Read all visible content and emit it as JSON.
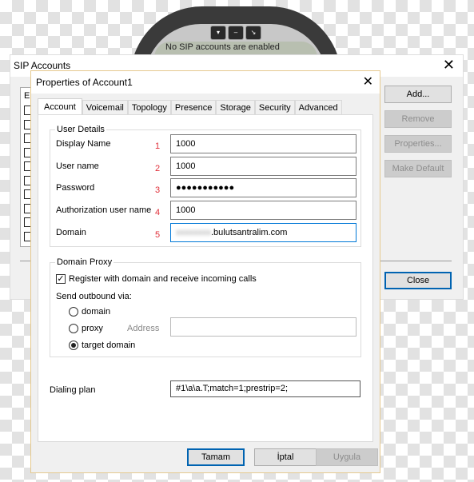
{
  "phone": {
    "status": "No SIP accounts are enabled",
    "buttons": [
      "▾",
      "–",
      "↘"
    ]
  },
  "sip_accounts": {
    "title": "SIP Accounts",
    "column_header": "En",
    "row_count": 10,
    "buttons": {
      "add": "Add...",
      "remove": "Remove",
      "properties": "Properties...",
      "make_default": "Make Default",
      "close": "Close"
    }
  },
  "dialog": {
    "title": "Properties of Account1",
    "tabs": [
      {
        "label": "Account",
        "active": true
      },
      {
        "label": "Voicemail"
      },
      {
        "label": "Topology"
      },
      {
        "label": "Presence"
      },
      {
        "label": "Storage"
      },
      {
        "label": "Security"
      },
      {
        "label": "Advanced"
      }
    ],
    "user_details": {
      "legend": "User Details",
      "fields": [
        {
          "label": "Display Name",
          "num": "1",
          "value": "1000"
        },
        {
          "label": "User name",
          "num": "2",
          "value": "1000"
        },
        {
          "label": "Password",
          "num": "3",
          "value": "●●●●●●●●●●●"
        },
        {
          "label": "Authorization user name",
          "num": "4",
          "value": "1000"
        },
        {
          "label": "Domain",
          "num": "5",
          "value": ".bulutsantralim.com"
        }
      ]
    },
    "domain_proxy": {
      "legend": "Domain Proxy",
      "register_label": "Register with domain and receive incoming calls",
      "register_checked": true,
      "send_outbound_label": "Send outbound via:",
      "options": [
        "domain",
        "proxy",
        "target domain"
      ],
      "selected": "target domain",
      "address_label": "Address",
      "address_value": ""
    },
    "dialing_plan": {
      "label": "Dialing plan",
      "value": "#1\\a\\a.T;match=1;prestrip=2;"
    },
    "buttons": {
      "ok": "Tamam",
      "cancel": "İptal",
      "apply": "Uygula"
    }
  }
}
